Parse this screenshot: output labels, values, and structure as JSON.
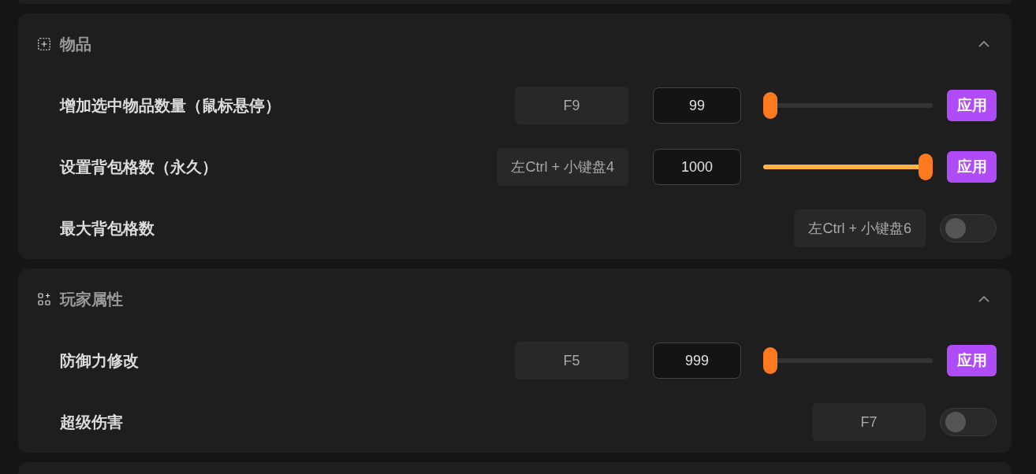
{
  "sections": [
    {
      "title": "物品",
      "expanded": true,
      "rows": [
        {
          "kind": "slider",
          "label": "增加选中物品数量（鼠标悬停）",
          "hotkey": "F9",
          "value": "99",
          "level": 0,
          "button": "应用"
        },
        {
          "kind": "slider",
          "label": "设置背包格数（永久）",
          "hotkey": "左Ctrl + 小键盘4",
          "value": "1000",
          "level": 1,
          "button": "应用"
        },
        {
          "kind": "toggle",
          "label": "最大背包格数",
          "hotkey": "左Ctrl + 小键盘6",
          "on": false
        }
      ]
    },
    {
      "title": "玩家属性",
      "expanded": true,
      "rows": [
        {
          "kind": "slider",
          "label": "防御力修改",
          "hotkey": "F5",
          "value": "999",
          "level": 0,
          "button": "应用"
        },
        {
          "kind": "toggle",
          "label": "超级伤害",
          "hotkey": "F7",
          "on": false
        }
      ]
    }
  ]
}
